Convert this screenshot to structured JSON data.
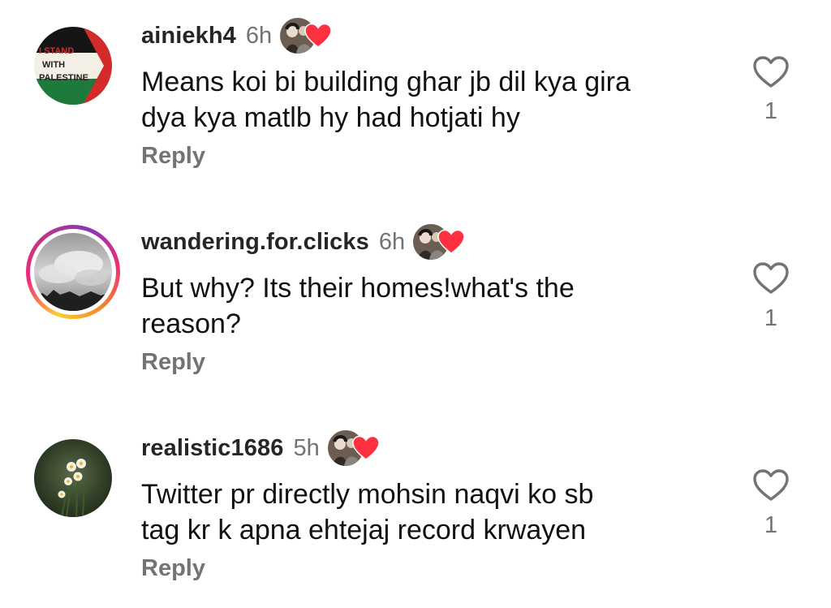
{
  "comments": [
    {
      "username": "ainiekh4",
      "time": "6h",
      "text_line1": "Means koi bi building ghar jb dil kya gira",
      "text_line2": "dya kya matlb hy had hotjati hy",
      "reply_label": "Reply",
      "like_count": "1",
      "avatar_text": [
        "I STAND",
        "WITH",
        "PALESTINE"
      ],
      "liked_by_author": true
    },
    {
      "username": "wandering.for.clicks",
      "time": "6h",
      "text_line1": "But why? Its their homes!what's the",
      "text_line2": "reason?",
      "reply_label": "Reply",
      "like_count": "1",
      "has_story_ring": true,
      "liked_by_author": true
    },
    {
      "username": "realistic1686",
      "time": "5h",
      "text_line1": "Twitter pr directly mohsin naqvi ko sb",
      "text_line2": "tag kr k apna ehtejaj record krwayen",
      "reply_label": "Reply",
      "like_count": "1",
      "liked_by_author": true
    }
  ],
  "colors": {
    "heart_red": "#ff3040",
    "muted_text": "#737373",
    "username": "#262626"
  },
  "icons": {
    "like": "heart-outline-icon",
    "creator_like": "heart-filled-icon"
  }
}
